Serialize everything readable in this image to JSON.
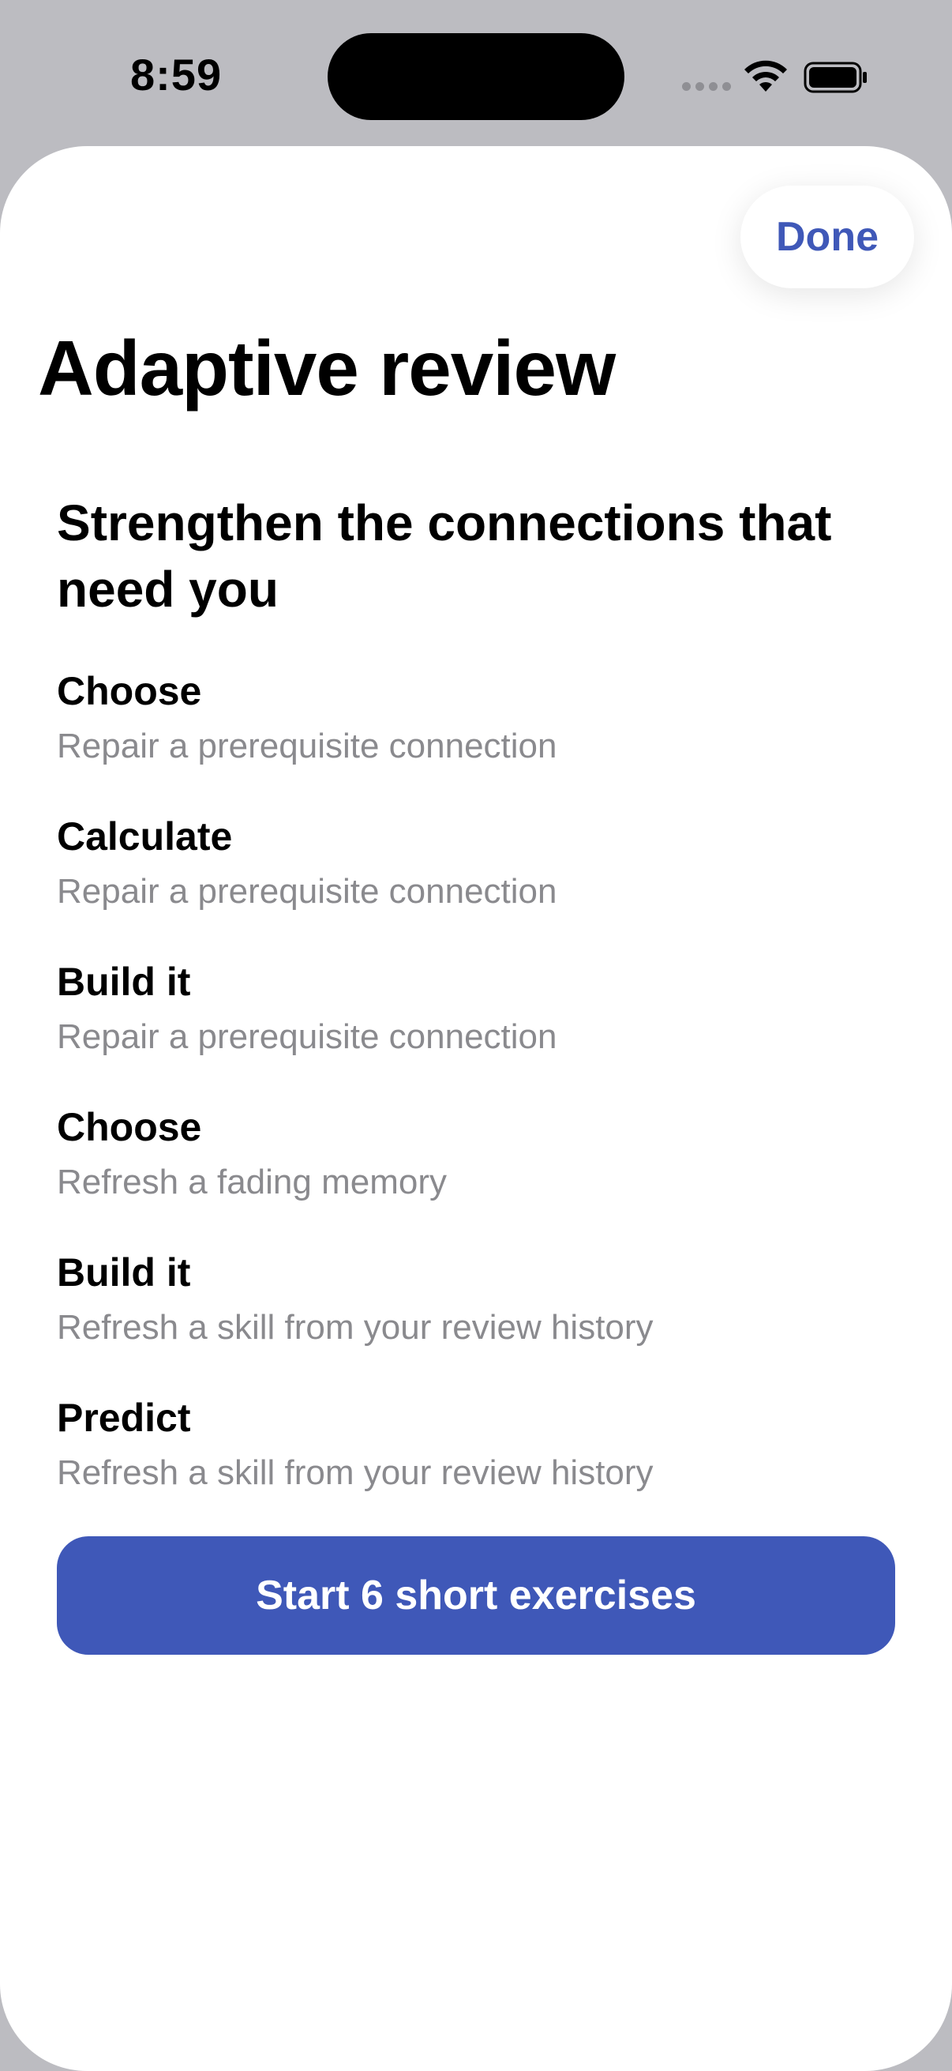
{
  "status_bar": {
    "time": "8:59"
  },
  "sheet": {
    "done_label": "Done",
    "title": "Adaptive review",
    "heading": "Strengthen the connections that need you",
    "items": [
      {
        "title": "Choose",
        "subtitle": "Repair a prerequisite connection"
      },
      {
        "title": "Calculate",
        "subtitle": "Repair a prerequisite connection"
      },
      {
        "title": "Build it",
        "subtitle": "Repair a prerequisite connection"
      },
      {
        "title": "Choose",
        "subtitle": "Refresh a fading memory"
      },
      {
        "title": "Build it",
        "subtitle": "Refresh a skill from your review history"
      },
      {
        "title": "Predict",
        "subtitle": "Refresh a skill from your review history"
      }
    ],
    "start_label": "Start 6 short exercises"
  },
  "colors": {
    "accent": "#3f58b8",
    "secondary_text": "#8a8a8e",
    "backdrop": "#bcbcc1"
  }
}
